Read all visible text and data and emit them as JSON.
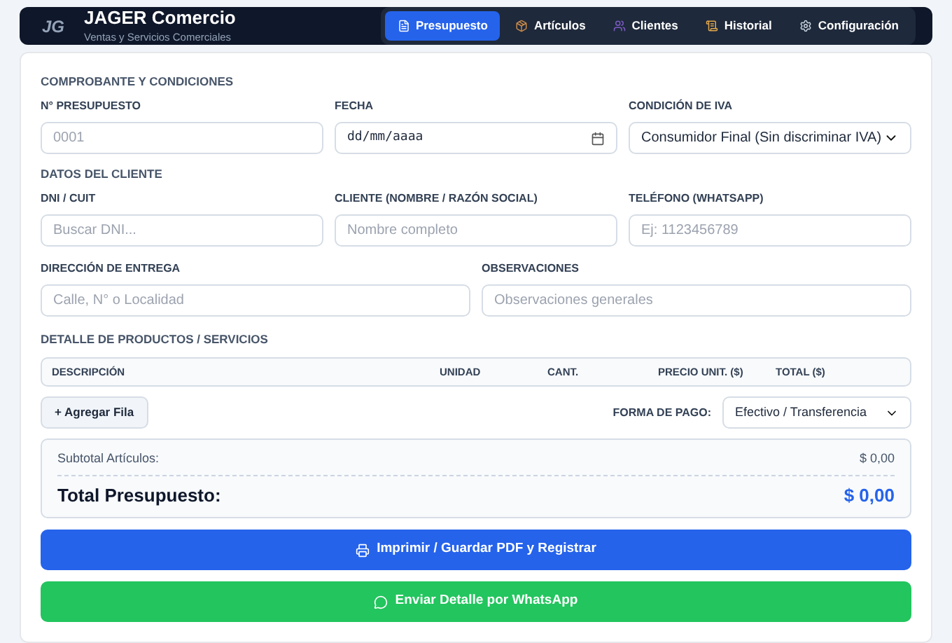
{
  "header": {
    "logo": "JG",
    "title": "JAGER Comercio",
    "subtitle": "Ventas y Servicios Comerciales"
  },
  "tabs": [
    {
      "label": "Presupuesto",
      "kind": "document",
      "selected": true
    },
    {
      "label": "Artículos",
      "kind": "package",
      "selected": false
    },
    {
      "label": "Clientes",
      "kind": "users",
      "selected": false
    },
    {
      "label": "Historial",
      "kind": "scroll",
      "selected": false
    },
    {
      "label": "Configuración",
      "kind": "gear",
      "selected": false
    }
  ],
  "sections": [
    {
      "title": "COMPROBANTE Y CONDICIONES",
      "rows": [
        [
          {
            "label": "N° PRESUPUESTO",
            "kind": "text",
            "placeholder": "0001"
          },
          {
            "label": "FECHA",
            "kind": "date",
            "value": "dd/mm/aaaa"
          },
          {
            "label": "CONDICIÓN DE IVA",
            "kind": "select",
            "value": "Consumidor Final (Sin discriminar IVA)"
          }
        ]
      ]
    },
    {
      "title": "DATOS DEL CLIENTE",
      "rows": [
        [
          {
            "label": "DNI / CUIT",
            "kind": "text",
            "placeholder": "Buscar DNI..."
          },
          {
            "label": "CLIENTE (NOMBRE / RAZÓN SOCIAL)",
            "kind": "text",
            "placeholder": "Nombre completo"
          },
          {
            "label": "TELÉFONO (WHATSAPP)",
            "kind": "text",
            "placeholder": "Ej: 1123456789"
          }
        ],
        [
          {
            "label": "DIRECCIÓN DE ENTREGA",
            "kind": "text",
            "placeholder": "Calle, N° o Localidad"
          },
          {
            "label": "OBSERVACIONES",
            "kind": "text",
            "placeholder": "Observaciones generales"
          }
        ]
      ]
    }
  ],
  "products": {
    "title": "DETALLE DE PRODUCTOS / SERVICIOS",
    "columns": [
      "DESCRIPCIÓN",
      "UNIDAD",
      "CANT.",
      "PRECIO UNIT. ($)",
      "TOTAL ($)"
    ]
  },
  "add_row_button": "+ Agregar Fila",
  "payment": {
    "label": "FORMA DE PAGO:",
    "value": "Efectivo / Transferencia"
  },
  "totals": {
    "subtotal_label": "Subtotal Artículos:",
    "subtotal_value": "$ 0,00",
    "total_label": "Total Presupuesto:",
    "total_value": "$ 0,00"
  },
  "actions": [
    {
      "label": "Imprimir / Guardar PDF y Registrar",
      "kind": "print"
    },
    {
      "label": "Enviar Detalle por WhatsApp",
      "kind": "whatsapp"
    }
  ]
}
